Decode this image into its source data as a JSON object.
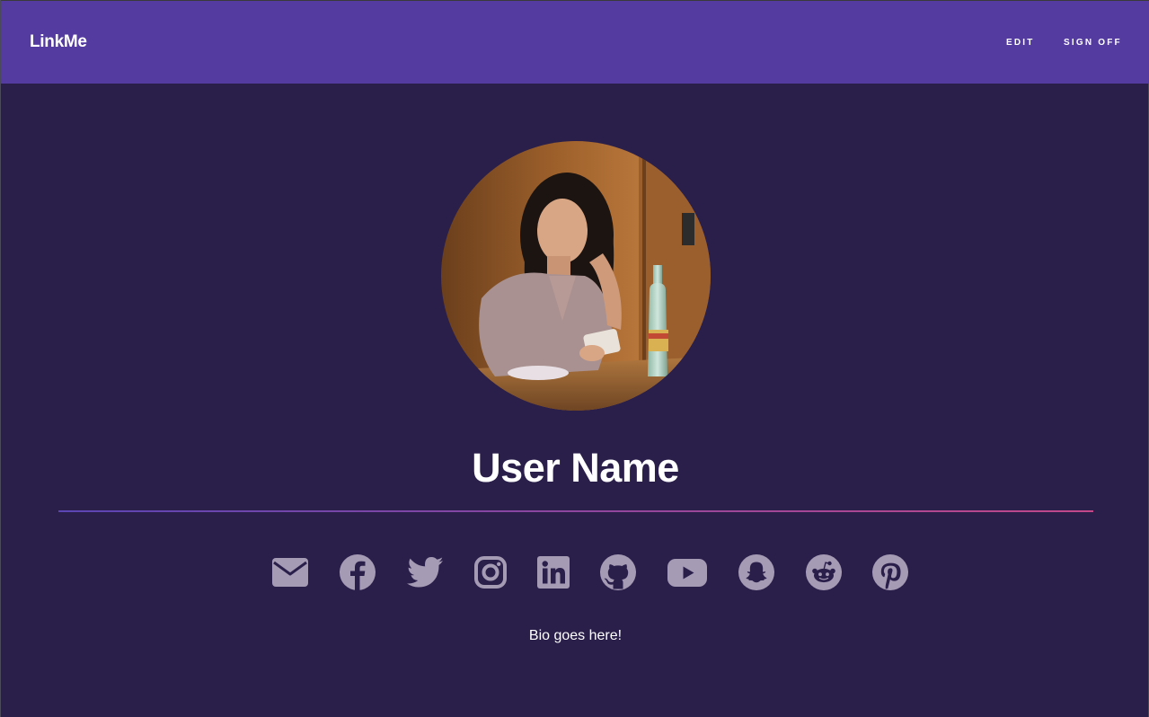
{
  "navbar": {
    "brand": "LinkMe",
    "links": [
      "EDIT",
      "SIGN OFF"
    ]
  },
  "profile": {
    "avatar": "profile-photo",
    "username": "User Name",
    "bio": "Bio goes here!"
  },
  "social_icons": [
    "email-icon",
    "facebook-icon",
    "twitter-icon",
    "instagram-icon",
    "linkedin-icon",
    "github-icon",
    "youtube-icon",
    "snapchat-icon",
    "reddit-icon",
    "pinterest-icon"
  ],
  "colors": {
    "navbar": "#543ba0",
    "background": "#2a1f4a",
    "icon": "#a69bb5",
    "divider_start": "#5b45b4",
    "divider_end": "#c2488a"
  }
}
